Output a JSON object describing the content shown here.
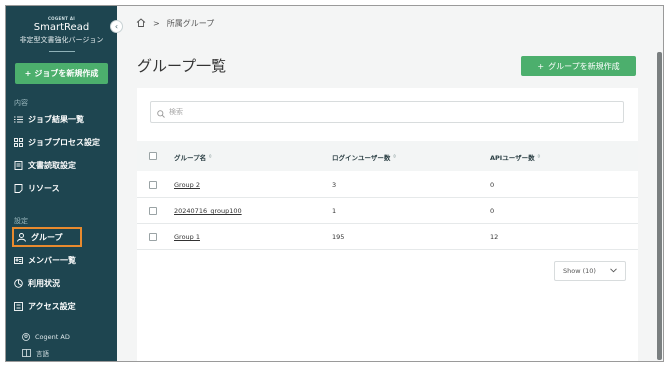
{
  "sidebar": {
    "brand_small": "COGENT AI",
    "brand_name": "SmartRead",
    "brand_sub": "非定型文書強化バージョン",
    "new_job_label": "ジョブを新規作成",
    "section_content": "内容",
    "section_settings": "設定",
    "items": [
      {
        "label": "ジョブ結果一覧",
        "icon": "list-icon"
      },
      {
        "label": "ジョブプロセス設定",
        "icon": "process-icon"
      },
      {
        "label": "文書読取設定",
        "icon": "document-icon"
      },
      {
        "label": "リソース",
        "icon": "resource-icon"
      },
      {
        "label": "グループ",
        "icon": "group-icon"
      },
      {
        "label": "メンバー一覧",
        "icon": "member-icon"
      },
      {
        "label": "利用状況",
        "icon": "usage-icon"
      },
      {
        "label": "アクセス設定",
        "icon": "access-icon"
      }
    ],
    "footer": [
      {
        "label": "Cogent AD",
        "icon": "user-icon"
      },
      {
        "label": "言語",
        "icon": "language-icon"
      }
    ],
    "highlight_color": "#e98a2e"
  },
  "breadcrumb": {
    "separator": ">",
    "current": "所属グループ"
  },
  "page": {
    "title": "グループ一覧",
    "create_button": "グループを新規作成"
  },
  "search": {
    "placeholder": "検索"
  },
  "table": {
    "headers": [
      "グループ名",
      "ログインユーザー数",
      "APIユーザー数"
    ],
    "rows": [
      {
        "name": "Group 2",
        "login_users": "3",
        "api_users": "0"
      },
      {
        "name": "20240716_group100",
        "login_users": "1",
        "api_users": "0"
      },
      {
        "name": "Group 1",
        "login_users": "195",
        "api_users": "12"
      }
    ]
  },
  "pagination": {
    "show_label": "Show (10)"
  },
  "colors": {
    "sidebar": "#1e4550",
    "accent_green": "#4caf6d"
  }
}
